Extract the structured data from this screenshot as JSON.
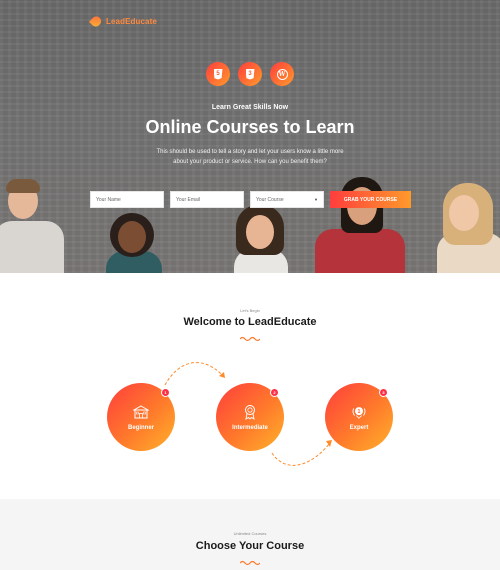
{
  "brand": {
    "name": "LeadEducate",
    "accent": "#ff6a3d",
    "accent_end": "#ffa92b"
  },
  "tech_icons": [
    {
      "icon": "html5-icon",
      "text": "5"
    },
    {
      "icon": "css3-icon",
      "text": "3"
    },
    {
      "icon": "wordpress-icon",
      "text": "W"
    }
  ],
  "hero": {
    "kicker": "Learn Great Skills Now",
    "title": "Online Courses to Learn",
    "desc_line1": "This should be used to tell a story and let your users know a little more",
    "desc_line2": "about your product or service. How can you benefit them?"
  },
  "form": {
    "name_placeholder": "Your Name",
    "email_placeholder": "Your Email",
    "course_placeholder": "Your Course",
    "button_label": "GRAB YOUR COURSE"
  },
  "welcome": {
    "eyebrow": "Let's Begin",
    "title": "Welcome to LeadEducate",
    "steps": [
      {
        "number": "1",
        "label": "Beginner",
        "icon": "school-icon"
      },
      {
        "number": "2",
        "label": "Intermediate",
        "icon": "award-ribbon-icon"
      },
      {
        "number": "3",
        "label": "Expert",
        "icon": "medal-laurel-icon"
      }
    ]
  },
  "choose": {
    "eyebrow": "Unlimited Courses",
    "title": "Choose Your Course"
  }
}
